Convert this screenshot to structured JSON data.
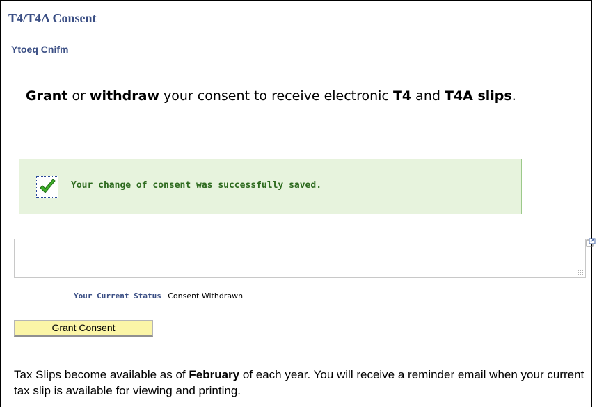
{
  "page": {
    "title": "T4/T4A Consent",
    "subtitle": "Ytoeq Cnifm"
  },
  "heading": {
    "part1": "Grant",
    "part2": " or ",
    "part3": "withdraw",
    "part4": " your consent to receive electronic ",
    "part5": "T4",
    "part6": " and ",
    "part7": "T4A",
    "part8": " slips",
    "part9": "."
  },
  "message": {
    "text": "Your change of consent was successfully saved.",
    "icon": "checkmark-icon"
  },
  "status": {
    "label": "Your Current Status",
    "value": "Consent Withdrawn"
  },
  "grant_button": {
    "label": "Grant Consent"
  },
  "info": {
    "part1": "Tax Slips become available as of ",
    "part2": "February",
    "part3": " of each year. You will receive a reminder email when your current tax slip is available for viewing and printing."
  },
  "colors": {
    "title": "#3a4e84",
    "success_bg": "#e7f3dd",
    "success_text": "#2e6b1f",
    "button_bg": "#fbf5a7"
  }
}
